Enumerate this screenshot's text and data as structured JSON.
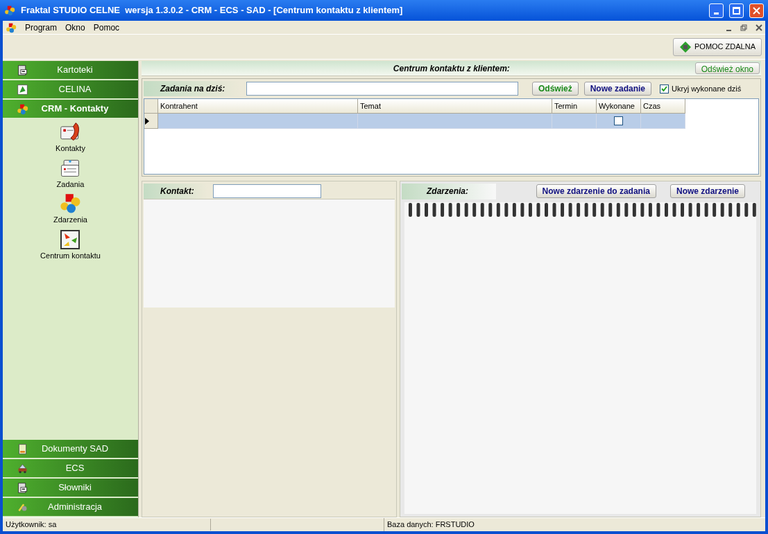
{
  "window": {
    "title": "Fraktal STUDIO CELNE  wersja 1.3.0.2 - CRM - ECS - SAD - [Centrum kontaktu z klientem]"
  },
  "menu": [
    {
      "label": "Program"
    },
    {
      "label": "Okno"
    },
    {
      "label": "Pomoc"
    }
  ],
  "toolbar": {
    "remote_help_button": "POMOC ZDALNA"
  },
  "sidebar": {
    "top_groups": [
      {
        "label": "Kartoteki",
        "selected": false
      },
      {
        "label": "CELINA",
        "selected": false
      },
      {
        "label": "CRM - Kontakty",
        "selected": true
      }
    ],
    "items": [
      {
        "label": "Kontakty"
      },
      {
        "label": "Zadania"
      },
      {
        "label": "Zdarzenia"
      },
      {
        "label": "Centrum kontaktu"
      }
    ],
    "bottom_groups": [
      {
        "label": "Dokumenty SAD",
        "selected": false
      },
      {
        "label": "ECS",
        "selected": false
      },
      {
        "label": "Słowniki",
        "selected": false
      },
      {
        "label": "Administracja",
        "selected": false
      }
    ]
  },
  "header": {
    "title": "Centrum kontaktu z klientem:",
    "refresh_button": "Odśwież okno"
  },
  "tasks": {
    "label": "Zadania na dziś:",
    "refresh_button": "Odśwież",
    "new_button": "Nowe zadanie",
    "hide_done": {
      "label": "Ukryj wykonane dziś",
      "checked": true
    },
    "columns": [
      "Kontrahent",
      "Temat",
      "Termin",
      "Wykonane",
      "Czas"
    ],
    "rows": [
      {
        "selected": true,
        "done": false
      }
    ]
  },
  "contact": {
    "label": "Kontakt:"
  },
  "events": {
    "label": "Zdarzenia:",
    "buttons": [
      "Nowe zdarzenie do zadania",
      "Nowe zdarzenie"
    ]
  },
  "status_bar": {
    "user": "Użytkownik: sa",
    "database": "Baza danych: FRSTUDIO"
  }
}
